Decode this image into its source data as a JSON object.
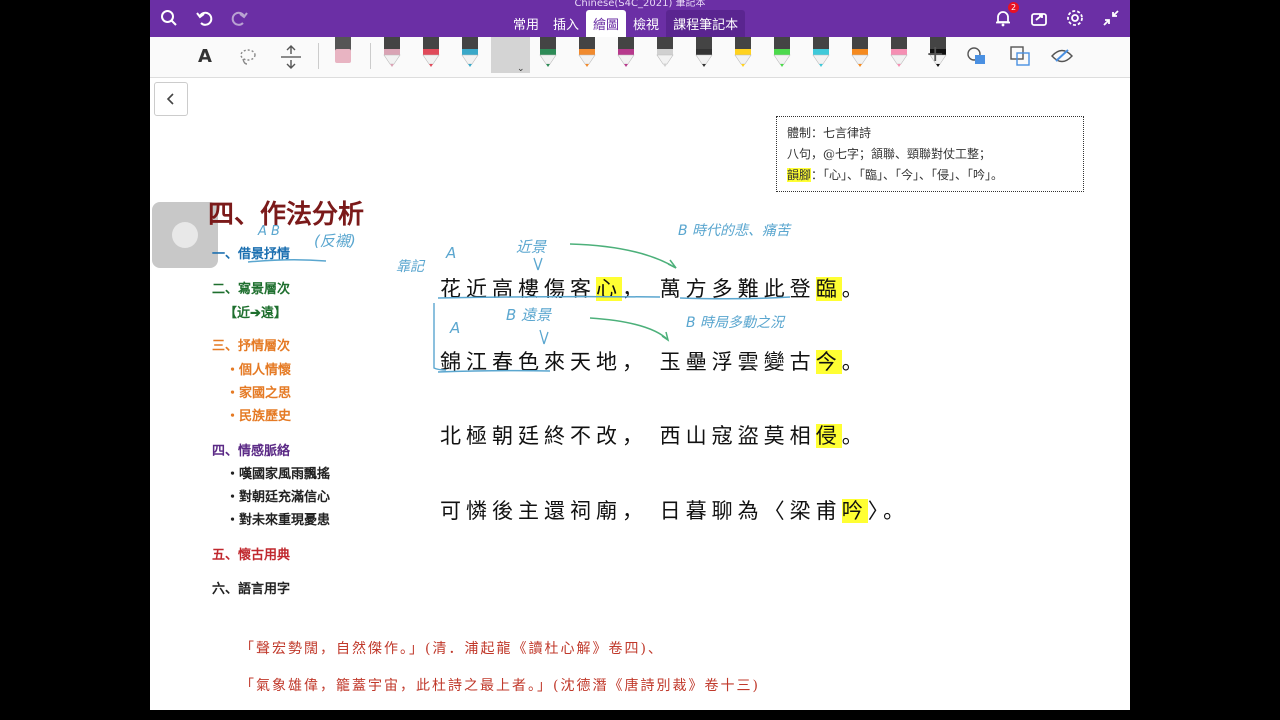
{
  "app": {
    "doc_title": "Chinese(S4C_2021) 筆記本"
  },
  "tabs": [
    {
      "label": "常用"
    },
    {
      "label": "插入"
    },
    {
      "label": "繪圖"
    },
    {
      "label": "檢視"
    },
    {
      "label": "課程筆記本"
    }
  ],
  "toolbar": {
    "notification_count": "2",
    "text_tool_label": "A"
  },
  "pens": {
    "colors": [
      "#d9a3b4",
      "#e04a5a",
      "#3aa8c8",
      "#3d73b8",
      "#2e8b57",
      "#f08a2e",
      "#b6398c",
      "#d0d0d0",
      "#333333",
      "#ffd21f",
      "#4cd94c",
      "#3fc9d9",
      "#f58a1f",
      "#f58fb3",
      "#111111"
    ]
  },
  "infobox": {
    "line1": "體制：七言律詩",
    "line2": "八句，@七字；頷聯、頸聯對仗工整；",
    "line3_hl": "韻腳",
    "line3_rest": "：「心」、「臨」、「今」、「侵」、「吟」。"
  },
  "heading": "四、作法分析",
  "outline": {
    "item1": "一、借景抒情",
    "item2": "二、寫景層次",
    "item2_sub": "【近➔遠】",
    "item3": "三、抒情層次",
    "item3_subs": [
      "‧個人情懷",
      "‧家國之思",
      "‧民族歷史"
    ],
    "item4": "四、情感脈絡",
    "item4_subs": [
      "‧嘆國家風雨飄搖",
      "‧對朝廷充滿信心",
      "‧對未來重現憂患"
    ],
    "item5": "五、懷古用典",
    "item6": "六、語言用字"
  },
  "poem": {
    "line1_a": "花近高樓傷客",
    "line1_rhyme": "心",
    "line1_b": "，  萬方多難此登",
    "line1_rhyme2": "臨",
    "line1_end": "。",
    "line2_a": "錦江春色來天地，  玉壘浮雲變古",
    "line2_rhyme": "今",
    "line2_end": "。",
    "line3_a": "北極朝廷終不改，  西山寇盜莫相",
    "line3_rhyme": "侵",
    "line3_end": "。",
    "line4_a": "可憐後主還祠廟，  日暮聊為〈梁甫",
    "line4_rhyme": "吟",
    "line4_end": "〉。"
  },
  "handwriting": {
    "ab1": "A  B",
    "fanchen": "(反襯)",
    "a_left": "A",
    "sub_left": "靠記",
    "near": "近景",
    "b_right1": "B  時代的悲、痛苦",
    "a2": "A",
    "far": "B 遠景",
    "b_right2": "B  時局多動之況",
    "a_small": "A"
  },
  "quotes": {
    "q1": "「聲宏勢闊，自然傑作。」(清．浦起龍《讀杜心解》卷四)、",
    "q2": "「氣象雄偉，籠蓋宇宙，此杜詩之最上者。」(沈德潛《唐詩別裁》卷十三)"
  },
  "colors": {
    "accent": "#6b2fa5",
    "highlight": "#ffff33",
    "heading": "#7b1a1a",
    "ink_blue": "#5aa6cf"
  }
}
